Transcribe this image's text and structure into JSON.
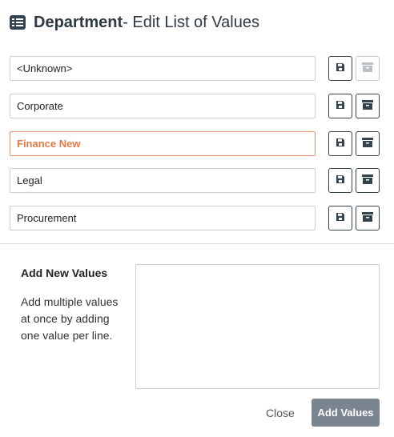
{
  "header": {
    "icon": "list-icon",
    "title_strong": "Department",
    "title_rest": " - Edit List of Values"
  },
  "values": [
    {
      "value": "<Unknown>",
      "editing": false,
      "archive_disabled": true
    },
    {
      "value": "Corporate",
      "editing": false,
      "archive_disabled": false
    },
    {
      "value": "Finance New",
      "editing": true,
      "archive_disabled": false
    },
    {
      "value": "Legal",
      "editing": false,
      "archive_disabled": false
    },
    {
      "value": "Procurement",
      "editing": false,
      "archive_disabled": false
    }
  ],
  "add_section": {
    "title": "Add New Values",
    "description": "Add multiple values at once by adding one value per line.",
    "textarea_value": ""
  },
  "footer": {
    "close_label": "Close",
    "add_label": "Add Values"
  },
  "colors": {
    "primary_dark": "#34444f",
    "editing_accent": "#e37a44",
    "add_button_bg": "#7a8590"
  }
}
